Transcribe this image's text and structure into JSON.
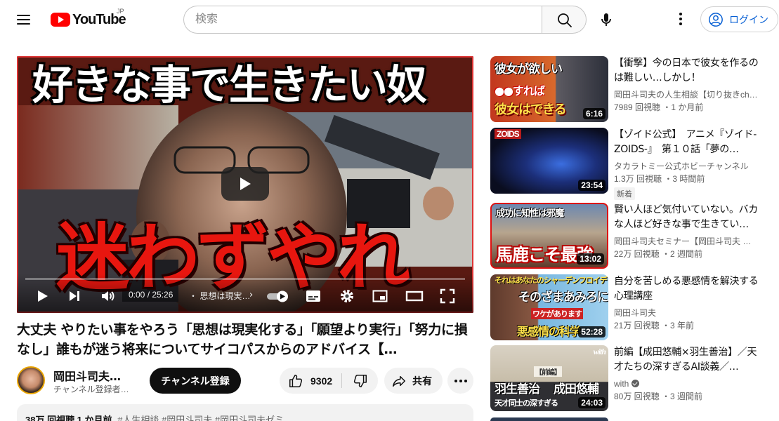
{
  "header": {
    "logo_text": "YouTube",
    "region": "JP",
    "search_placeholder": "検索",
    "login_label": "ログイン"
  },
  "player": {
    "thumbnail_headline": "好きな事で生きたい奴",
    "thumbnail_big_text": "迷わずやれ",
    "time_current": "0:00",
    "time_separator": " / ",
    "time_total": "25:26",
    "chapter_label": "・ 思想は現実…",
    "progress": 0
  },
  "video": {
    "title": "大丈夫 やりたい事をやろう「思想は現実化する」「願望より実行」「努力に損なし」誰もが迷う将来についてサイコパスからのアドバイス【…",
    "channel_name": "岡田斗司夫セ…",
    "subscribers": "チャンネル登録者…",
    "subscribe_label": "チャンネル登録",
    "like_count": "9302",
    "share_label": "共有",
    "description_meta": "38万 回視聴  1 か月前",
    "description_tags": "#人生相談 #岡田斗司夫 #岡田斗司夫ゼミ"
  },
  "recommendations": [
    {
      "title": "【衝撃】今の日本で彼女を作るのは難しい…しかし！",
      "channel": "岡田斗司夫の人生相談【切り抜きch…",
      "stats": "7989 回視聴 ・1 か月前",
      "duration": "6:16",
      "thumb_text_1": "彼女が欲しい",
      "thumb_text_2": "●●すれば",
      "thumb_text_3": "彼女はできる",
      "badge": "",
      "verified": false
    },
    {
      "title": "【ゾイド公式】　アニメ『ゾイド-ZOIDS-』　第１０話「夢の…",
      "channel": "タカラトミー公式ホビーチャンネル",
      "stats": "1.3万 回視聴 ・3 時間前",
      "duration": "23:54",
      "thumb_text_1": "ZOIDS",
      "badge": "新着",
      "verified": false
    },
    {
      "title": "賢い人ほど気付いていない。バカな人ほど好きな事で生きてい…",
      "channel": "岡田斗司夫セミナー【岡田斗司夫 …",
      "stats": "22万 回視聴 ・2 週間前",
      "duration": "13:02",
      "thumb_text_1": "成功に知性は邪魔",
      "thumb_text_2": "馬鹿こそ最強",
      "badge": "",
      "verified": false
    },
    {
      "title": "自分を苦しめる悪感情を解決する心理講座",
      "channel": "岡田斗司夫",
      "stats": "21万 回視聴 ・3 年前",
      "duration": "52:28",
      "thumb_text_1": "それはあなたのシャーデンフロイデ",
      "thumb_text_2": "そのざまあみろには",
      "thumb_text_3": "ワケがあります",
      "thumb_text_4": "悪感情の科学",
      "badge": "",
      "verified": false
    },
    {
      "title": "前編【成田悠輔×羽生善治】／天才たちの深すぎるAI談義／…",
      "channel": "with",
      "stats": "80万 回視聴 ・3 週間前",
      "duration": "24:03",
      "thumb_text_1": "羽生善治",
      "thumb_text_2": "成田悠輔",
      "thumb_text_3": "天才同士の深すぎる",
      "thumb_text_4": "【前編】",
      "thumb_text_5": "with",
      "badge": "",
      "verified": true
    }
  ],
  "colors": {
    "brand_red": "#ff0000",
    "link_blue": "#065fd4",
    "thumb_red": "#e8160f"
  }
}
